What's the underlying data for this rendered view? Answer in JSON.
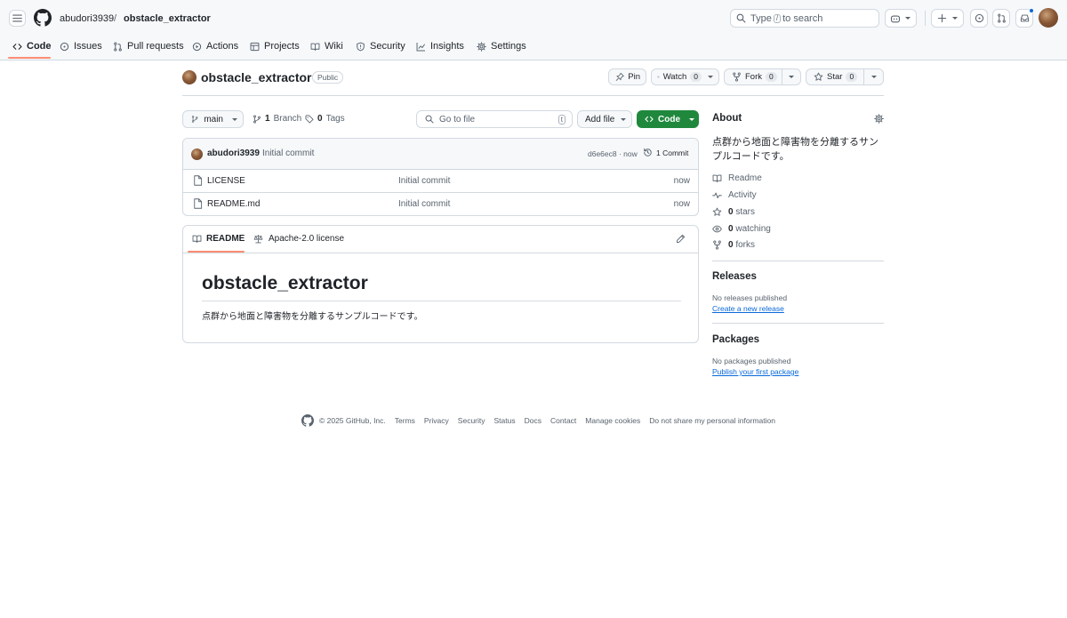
{
  "header": {
    "owner": "abudori3939",
    "separator": "/",
    "repo": "obstacle_extractor",
    "search": {
      "prefix": "Type",
      "key": "/",
      "suffix": "to search"
    }
  },
  "repo_nav": {
    "items": [
      {
        "label": "Code",
        "icon": "code-icon",
        "active": true
      },
      {
        "label": "Issues",
        "icon": "issue-icon"
      },
      {
        "label": "Pull requests",
        "icon": "pull-request-icon"
      },
      {
        "label": "Actions",
        "icon": "play-icon"
      },
      {
        "label": "Projects",
        "icon": "table-icon"
      },
      {
        "label": "Wiki",
        "icon": "book-icon"
      },
      {
        "label": "Security",
        "icon": "shield-icon"
      },
      {
        "label": "Insights",
        "icon": "graph-icon"
      },
      {
        "label": "Settings",
        "icon": "gear-icon"
      }
    ]
  },
  "repo_header": {
    "name": "obstacle_extractor",
    "visibility": "Public",
    "pin_label": "Pin",
    "watch_label": "Watch",
    "watch_count": "0",
    "fork_label": "Fork",
    "fork_count": "0",
    "star_label": "Star",
    "star_count": "0"
  },
  "file_nav": {
    "branch": "main",
    "branch_count": "1",
    "branch_label": "Branch",
    "tag_count": "0",
    "tag_label": "Tags",
    "goto_placeholder": "Go to file",
    "goto_key": "t",
    "add_file_label": "Add file",
    "code_label": "Code"
  },
  "commit": {
    "author": "abudori3939",
    "message": "Initial commit",
    "hash_time": "d6e6ec8 · now",
    "commits_label": "1 Commit"
  },
  "files": [
    {
      "name": "LICENSE",
      "message": "Initial commit",
      "time": "now"
    },
    {
      "name": "README.md",
      "message": "Initial commit",
      "time": "now"
    }
  ],
  "readme": {
    "tab_readme": "README",
    "tab_license": "Apache-2.0 license",
    "heading": "obstacle_extractor",
    "body": "点群から地面と障害物を分離するサンプルコードです。"
  },
  "about": {
    "title": "About",
    "description": "点群から地面と障害物を分離するサンプルコードです。",
    "readme_label": "Readme",
    "activity_label": "Activity",
    "stars_count": "0",
    "stars_label": "stars",
    "watching_count": "0",
    "watching_label": "watching",
    "forks_count": "0",
    "forks_label": "forks"
  },
  "releases": {
    "title": "Releases",
    "empty": "No releases published",
    "link": "Create a new release"
  },
  "packages": {
    "title": "Packages",
    "empty": "No packages published",
    "link": "Publish your first package"
  },
  "footer": {
    "copyright": "© 2025 GitHub, Inc.",
    "links": [
      "Terms",
      "Privacy",
      "Security",
      "Status",
      "Docs",
      "Contact",
      "Manage cookies",
      "Do not share my personal information"
    ]
  },
  "colors": {
    "accent": "#fd8c73",
    "link": "#0969da",
    "code_button": "#1f883d",
    "notification_dot": "#0969da"
  }
}
